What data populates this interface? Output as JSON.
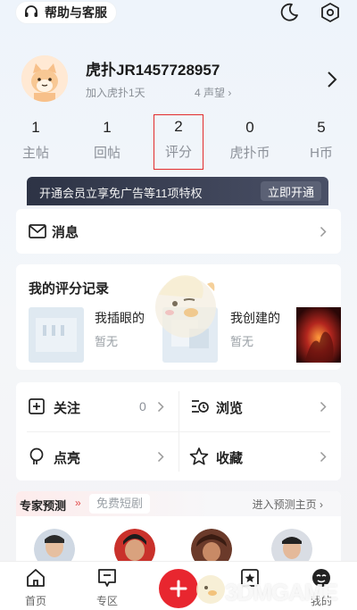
{
  "header": {
    "help_label": "帮助与客服",
    "icons": [
      "headset-icon",
      "moon-icon",
      "settings-hex-icon"
    ]
  },
  "profile": {
    "username": "虎扑JR1457728957",
    "joined": "加入虎扑1天",
    "fame": "4 声望 ›"
  },
  "stats": [
    {
      "num": "1",
      "label": "主帖"
    },
    {
      "num": "1",
      "label": "回帖"
    },
    {
      "num": "2",
      "label": "评分"
    },
    {
      "num": "0",
      "label": "虎扑币"
    },
    {
      "num": "5",
      "label": "H币"
    }
  ],
  "vip": {
    "text": "开通会员立享免广告等11项特权",
    "button": "立即开通"
  },
  "messages": {
    "label": "消息"
  },
  "score_record": {
    "title": "我的评分记录",
    "items": [
      {
        "name": "我插眼的",
        "status": "暂无"
      },
      {
        "name": "我创建的",
        "status": "暂无"
      }
    ]
  },
  "menu": [
    {
      "label": "关注",
      "count": "0"
    },
    {
      "label": "浏览",
      "count": ""
    },
    {
      "label": "点亮",
      "count": ""
    },
    {
      "label": "收藏",
      "count": ""
    }
  ],
  "expert": {
    "title": "专家预测",
    "chevrons": "»",
    "tab": "免费短剧",
    "link": "进入预测主页 ›"
  },
  "tabbar": [
    {
      "label": "首页",
      "icon": "home-icon"
    },
    {
      "label": "专区",
      "icon": "chat-square-icon"
    },
    {
      "label": "",
      "icon": "plus-icon"
    },
    {
      "label": "",
      "icon": "star-square-icon"
    },
    {
      "label": "我的",
      "icon": "profile-icon"
    }
  ],
  "watermark": "3DMGAME",
  "colors": {
    "accent_red": "#e8262f",
    "vip_bg": "#2d3345",
    "muted_text": "#8c9199"
  }
}
